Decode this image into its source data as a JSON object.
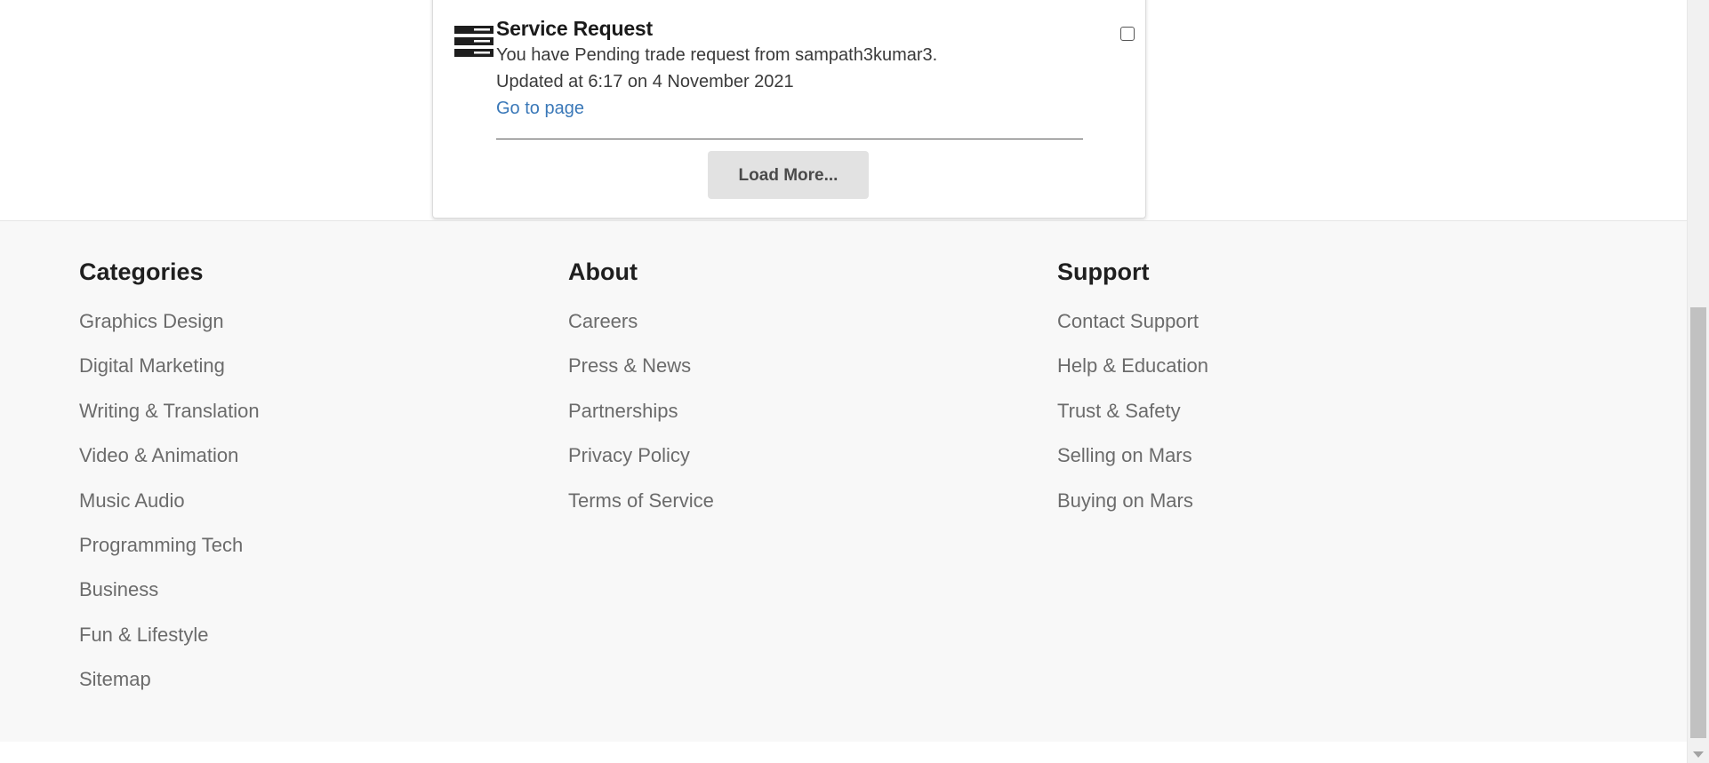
{
  "notification": {
    "icon": "server-request-icon",
    "title": "Service Request",
    "message": "You have Pending trade request from sampath3kumar3.",
    "updated": "Updated at 6:17 on 4 November 2021",
    "link_label": "Go to page",
    "checked": false
  },
  "load_more": {
    "label": "Load More..."
  },
  "footer": {
    "categories": {
      "heading": "Categories",
      "items": [
        "Graphics Design",
        "Digital Marketing",
        "Writing & Translation",
        "Video & Animation",
        "Music Audio",
        "Programming Tech",
        "Business",
        "Fun & Lifestyle",
        "Sitemap"
      ]
    },
    "about": {
      "heading": "About",
      "items": [
        "Careers",
        "Press & News",
        "Partnerships",
        "Privacy Policy",
        "Terms of Service"
      ]
    },
    "support": {
      "heading": "Support",
      "items": [
        "Contact Support",
        "Help & Education",
        "Trust & Safety",
        "Selling on Mars",
        "Buying on Mars"
      ]
    }
  },
  "colors": {
    "link": "#3a78b8",
    "footer_bg": "#f8f8f8",
    "button_bg": "#e2e2e2"
  }
}
